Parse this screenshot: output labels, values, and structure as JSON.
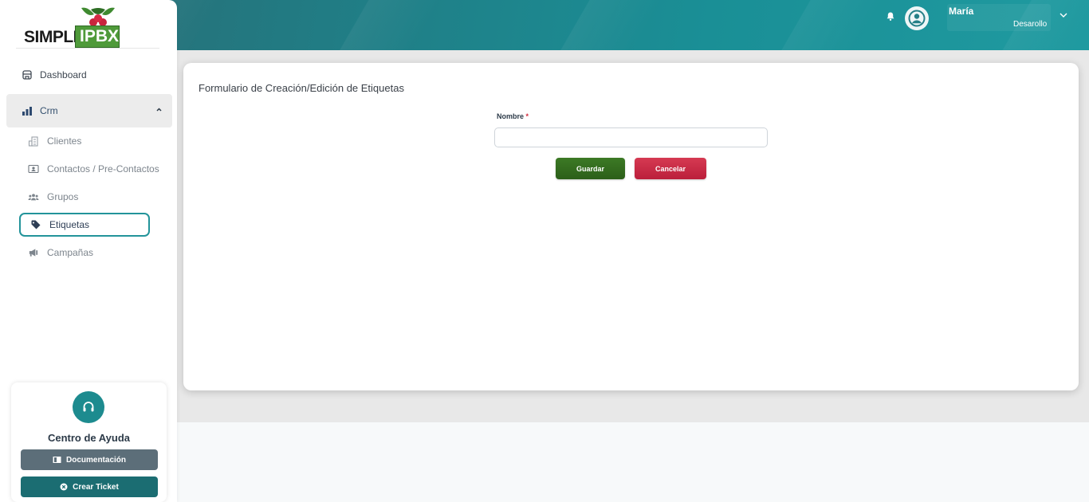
{
  "header": {
    "user_name": "María",
    "user_department": "Desarollo",
    "brand_color": "#1a8f96"
  },
  "logo": {
    "text_left": "SIMPLE",
    "text_box": "IPBX"
  },
  "sidebar": {
    "items": [
      {
        "label": "Dashboard",
        "icon": "dashboard-icon"
      },
      {
        "label": "Crm",
        "icon": "crm-chart-icon",
        "expanded": true
      },
      {
        "label": "Clientes",
        "icon": "building-icon"
      },
      {
        "label": "Contactos / Pre-Contactos",
        "icon": "contact-card-icon"
      },
      {
        "label": "Grupos",
        "icon": "users-icon"
      },
      {
        "label": "Etiquetas",
        "icon": "tag-icon",
        "active": true
      },
      {
        "label": "Campañas",
        "icon": "megaphone-icon"
      }
    ]
  },
  "help": {
    "title": "Centro de Ayuda",
    "doc_label": "Documentación",
    "ticket_label": "Crear Ticket"
  },
  "form": {
    "title": "Formulario de Creación/Edición de Etiquetas",
    "name_label": "Nombre",
    "required_mark": "*",
    "name_value": "",
    "save_label": "Guardar",
    "cancel_label": "Cancelar",
    "save_color": "#2f6a1c",
    "cancel_color": "#c92a45"
  }
}
